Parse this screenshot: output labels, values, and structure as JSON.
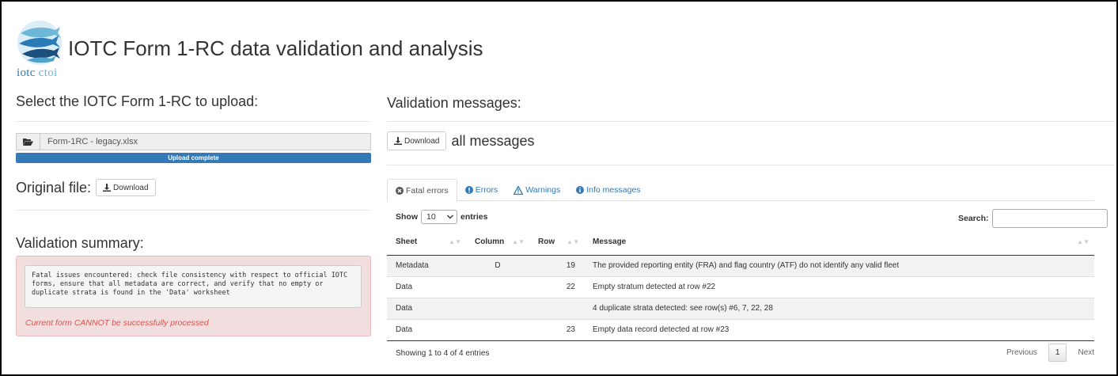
{
  "app": {
    "title": "IOTC Form 1-RC data validation and analysis",
    "logo_text_iotc": "iotc",
    "logo_text_ctoi": "ctoi"
  },
  "upload": {
    "title": "Select the IOTC Form 1-RC to upload:",
    "file_name": "Form-1RC - legacy.xlsx",
    "progress_label": "Upload complete",
    "progress": 1.0
  },
  "original": {
    "label": "Original file:",
    "download_label": "Download"
  },
  "summary": {
    "title": "Validation summary:",
    "message": "Fatal issues encountered: check file consistency with respect to official IOTC forms, ensure that all metadata are correct, and verify that no empty or duplicate strata is found in the 'Data' worksheet",
    "status": "Current form CANNOT be successfully processed"
  },
  "messages": {
    "title": "Validation messages:",
    "download_label": "Download",
    "all_label": "all messages"
  },
  "tabs": [
    {
      "label": "Fatal errors",
      "icon": "times-circle-icon",
      "active": true
    },
    {
      "label": "Errors",
      "icon": "exclamation-circle-icon",
      "active": false
    },
    {
      "label": "Warnings",
      "icon": "warning-triangle-icon",
      "active": false
    },
    {
      "label": "Info messages",
      "icon": "info-circle-icon",
      "active": false
    }
  ],
  "table": {
    "show_label": "Show",
    "entries_label": "entries",
    "length_value": "10",
    "search_label": "Search:",
    "columns": [
      "Sheet",
      "Column",
      "Row",
      "Message"
    ],
    "rows": [
      {
        "sheet": "Metadata",
        "column": "D",
        "row": "19",
        "message": "The provided reporting entity (FRA) and flag country (ATF) do not identify any valid fleet"
      },
      {
        "sheet": "Data",
        "column": "",
        "row": "22",
        "message": "Empty stratum detected at row #22"
      },
      {
        "sheet": "Data",
        "column": "",
        "row": "",
        "message": "4 duplicate strata detected: see row(s) #6, 7, 22, 28"
      },
      {
        "sheet": "Data",
        "column": "",
        "row": "23",
        "message": "Empty data record detected at row #23"
      }
    ],
    "info": "Showing 1 to 4 of 4 entries",
    "pager": {
      "previous": "Previous",
      "current": "1",
      "next": "Next"
    }
  },
  "colors": {
    "primary": "#337ab7",
    "danger_bg": "#f2dede",
    "danger_text": "#d9534f"
  }
}
